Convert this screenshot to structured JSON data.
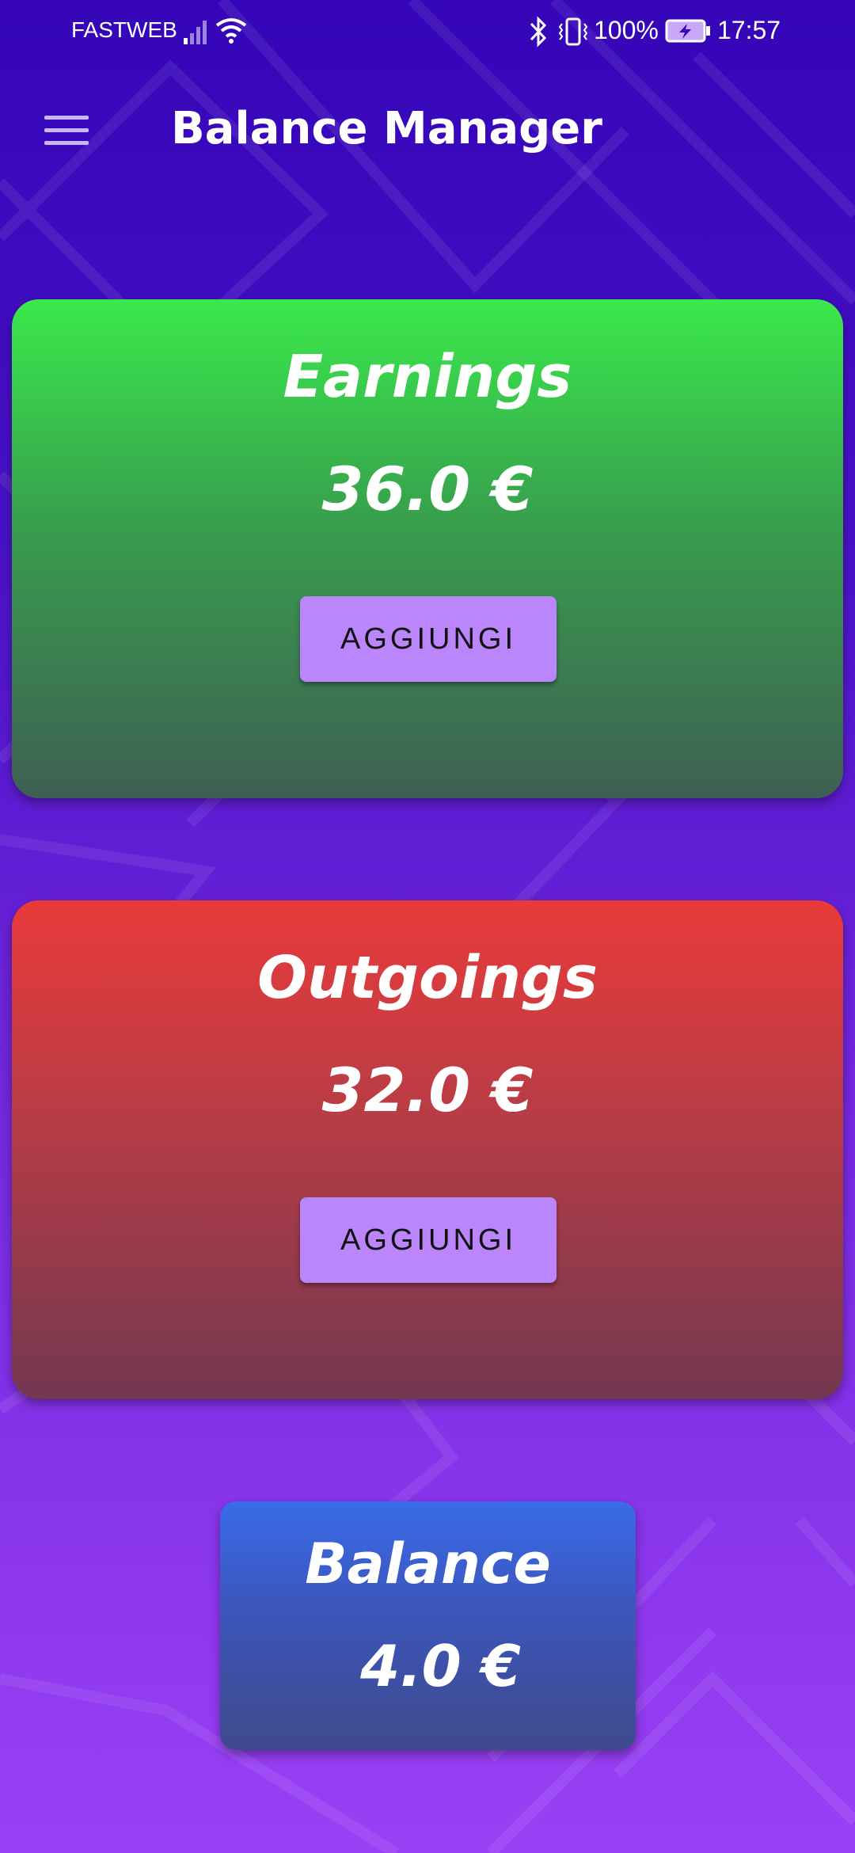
{
  "status_bar": {
    "carrier": "FASTWEB",
    "battery": "100%",
    "time": "17:57",
    "icons": [
      "signal-icon",
      "wifi-icon",
      "bluetooth-icon",
      "vibrate-icon",
      "battery-charging-icon"
    ]
  },
  "app_bar": {
    "title": "Balance Manager",
    "menu_icon": "hamburger-menu-icon"
  },
  "earnings": {
    "title": "Earnings",
    "amount": "36.0 €",
    "button_label": "AGGIUNGI",
    "color_top": "#3ae94c",
    "color_bottom": "#3e5f53"
  },
  "outgoings": {
    "title": "Outgoings",
    "amount": "32.0 €",
    "button_label": "AGGIUNGI",
    "color_top": "#e93a3a",
    "color_bottom": "#723850"
  },
  "balance": {
    "title": "Balance",
    "amount": "4.0 €",
    "color_top": "#3a6be9",
    "color_bottom": "#3f4a8c"
  },
  "colors": {
    "background_top": "#3505b8",
    "background_bottom": "#9a40f5",
    "button": "#bb86fc"
  }
}
